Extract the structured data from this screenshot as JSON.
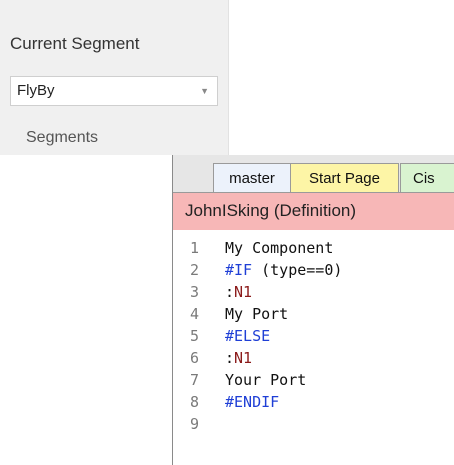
{
  "segment_panel": {
    "title": "Current Segment",
    "selected_segment": "FlyBy",
    "subheading": "Segments"
  },
  "editor": {
    "tabs": [
      {
        "label": "master",
        "color": "#ecf2fb"
      },
      {
        "label": "Start Page",
        "color": "#fdf5a6"
      },
      {
        "label": "Cis",
        "color": "#d9f3d0"
      }
    ],
    "header": "JohnISking (Definition)",
    "lines": [
      {
        "n": "1",
        "text": "My Component",
        "kind": "plain"
      },
      {
        "n": "2",
        "directive": "#IF",
        "rest": " (type==0)",
        "kind": "directive"
      },
      {
        "n": "3",
        "prefix": ":",
        "label": "N1",
        "kind": "label"
      },
      {
        "n": "4",
        "text": "My Port",
        "kind": "plain"
      },
      {
        "n": "5",
        "directive": "#ELSE",
        "rest": "",
        "kind": "directive"
      },
      {
        "n": "6",
        "prefix": ":",
        "label": "N1",
        "kind": "label"
      },
      {
        "n": "7",
        "text": "Your Port",
        "kind": "plain"
      },
      {
        "n": "8",
        "directive": "#ENDIF",
        "rest": "",
        "kind": "directive"
      },
      {
        "n": "9",
        "text": "",
        "kind": "plain"
      }
    ]
  },
  "colors": {
    "directive": "#1f3fd6",
    "label": "#8b1a1a",
    "header_bg": "#f7b7b7"
  }
}
